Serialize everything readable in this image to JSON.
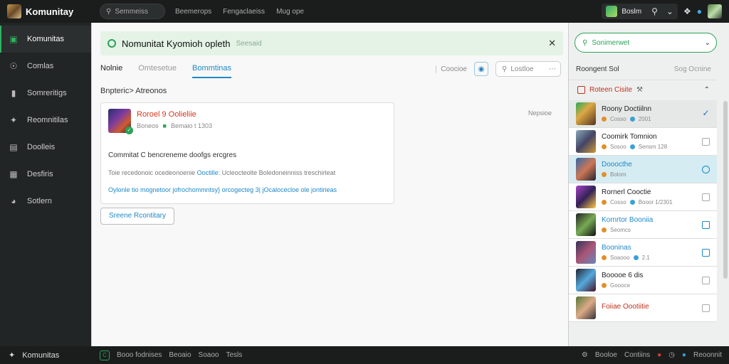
{
  "app": {
    "title": "Komunitay"
  },
  "topbar": {
    "search_label": "Semmeiss",
    "nav": [
      "Beemerops",
      "Fengaclaeiss",
      "Mug ope"
    ],
    "user_label": "Boslm"
  },
  "sidebar": {
    "items": [
      {
        "label": "Komunitas",
        "icon": "chat-icon"
      },
      {
        "label": "Comlas",
        "icon": "gear-icon"
      },
      {
        "label": "Somreritigs",
        "icon": "briefcase-icon"
      },
      {
        "label": "Reomnitilas",
        "icon": "puzzle-icon"
      },
      {
        "label": "Doolleis",
        "icon": "document-icon"
      },
      {
        "label": "Desfiris",
        "icon": "grid-icon"
      },
      {
        "label": "Sotlern",
        "icon": "compass-icon"
      }
    ]
  },
  "banner": {
    "title": "Nomunitat Kyomioh opleth",
    "subtitle": "Seesaid"
  },
  "tabs": [
    "Nolnie",
    "Omtesetue",
    "Bommtinas"
  ],
  "tools": {
    "link": "Coocioe",
    "search_placeholder": "Lostloe"
  },
  "section": {
    "title": "Bnpteric> Atreonos"
  },
  "card": {
    "name": "Roroel 9 Oolieliie",
    "meta1": "Boneos",
    "meta2": "Bemaio t 1303",
    "line1": "Commitat C bencreneme doofgs ercgres",
    "line2_a": "Toie recedonoic ocedeonoenie ",
    "line2_hl": "Ooctille:",
    "line2_b": " Ucleocteolte Boledoneinniss treschirleat",
    "line3": "Oylonle tio mognetoor jofrochommntsy} orcogecteg 3| jOcalocecloe ole jontirieas",
    "side_note": "Nepsioe"
  },
  "select_button": "Sreene Rcontitary",
  "rpanel": {
    "search_value": "Sonimerwet",
    "header_title": "Roongent Sol",
    "header_link": "Sog Ocnine",
    "group_label": "Roteen Cisite",
    "items": [
      {
        "name": "Roony Doctiilnn",
        "meta_a": "Cosso",
        "meta_b": "2001",
        "style": "",
        "state": "sel",
        "mark": "check"
      },
      {
        "name": "Coomirk Tomnion",
        "meta_a": "Sosoo",
        "meta_b": "Sensm 128",
        "style": "",
        "state": "",
        "mark": "box"
      },
      {
        "name": "Dooocthe",
        "meta_a": "Bolom",
        "meta_b": "",
        "style": "blue",
        "state": "hi",
        "mark": "circle"
      },
      {
        "name": "Rornerl Cooctie",
        "meta_a": "Cosso",
        "meta_b": "Booor 1/2301",
        "style": "",
        "state": "",
        "mark": "box"
      },
      {
        "name": "Kornrtor Booniia",
        "meta_a": "Seomcs",
        "meta_b": "",
        "style": "blue",
        "state": "",
        "mark": "bluebox"
      },
      {
        "name": "Booninas",
        "meta_a": "Soaooo",
        "meta_b": "2.1",
        "style": "blue",
        "state": "",
        "mark": "bluebox"
      },
      {
        "name": "Booooe 6 dis",
        "meta_a": "Goooce",
        "meta_b": "",
        "style": "",
        "state": "",
        "mark": "box"
      },
      {
        "name": "Foiiae Oootiitie",
        "meta_a": "",
        "meta_b": "",
        "style": "red",
        "state": "",
        "mark": "box"
      }
    ]
  },
  "bottombar": {
    "brand": "Komunitas",
    "items": [
      "Booo fodnises",
      "Beoaio",
      "Soaoo",
      "Tesls"
    ],
    "right": [
      "Booloe",
      "Contiins",
      "Reoonnit"
    ]
  },
  "colors": {
    "accent": "#2aa356",
    "link": "#1e88c8",
    "alert": "#d9361b"
  }
}
